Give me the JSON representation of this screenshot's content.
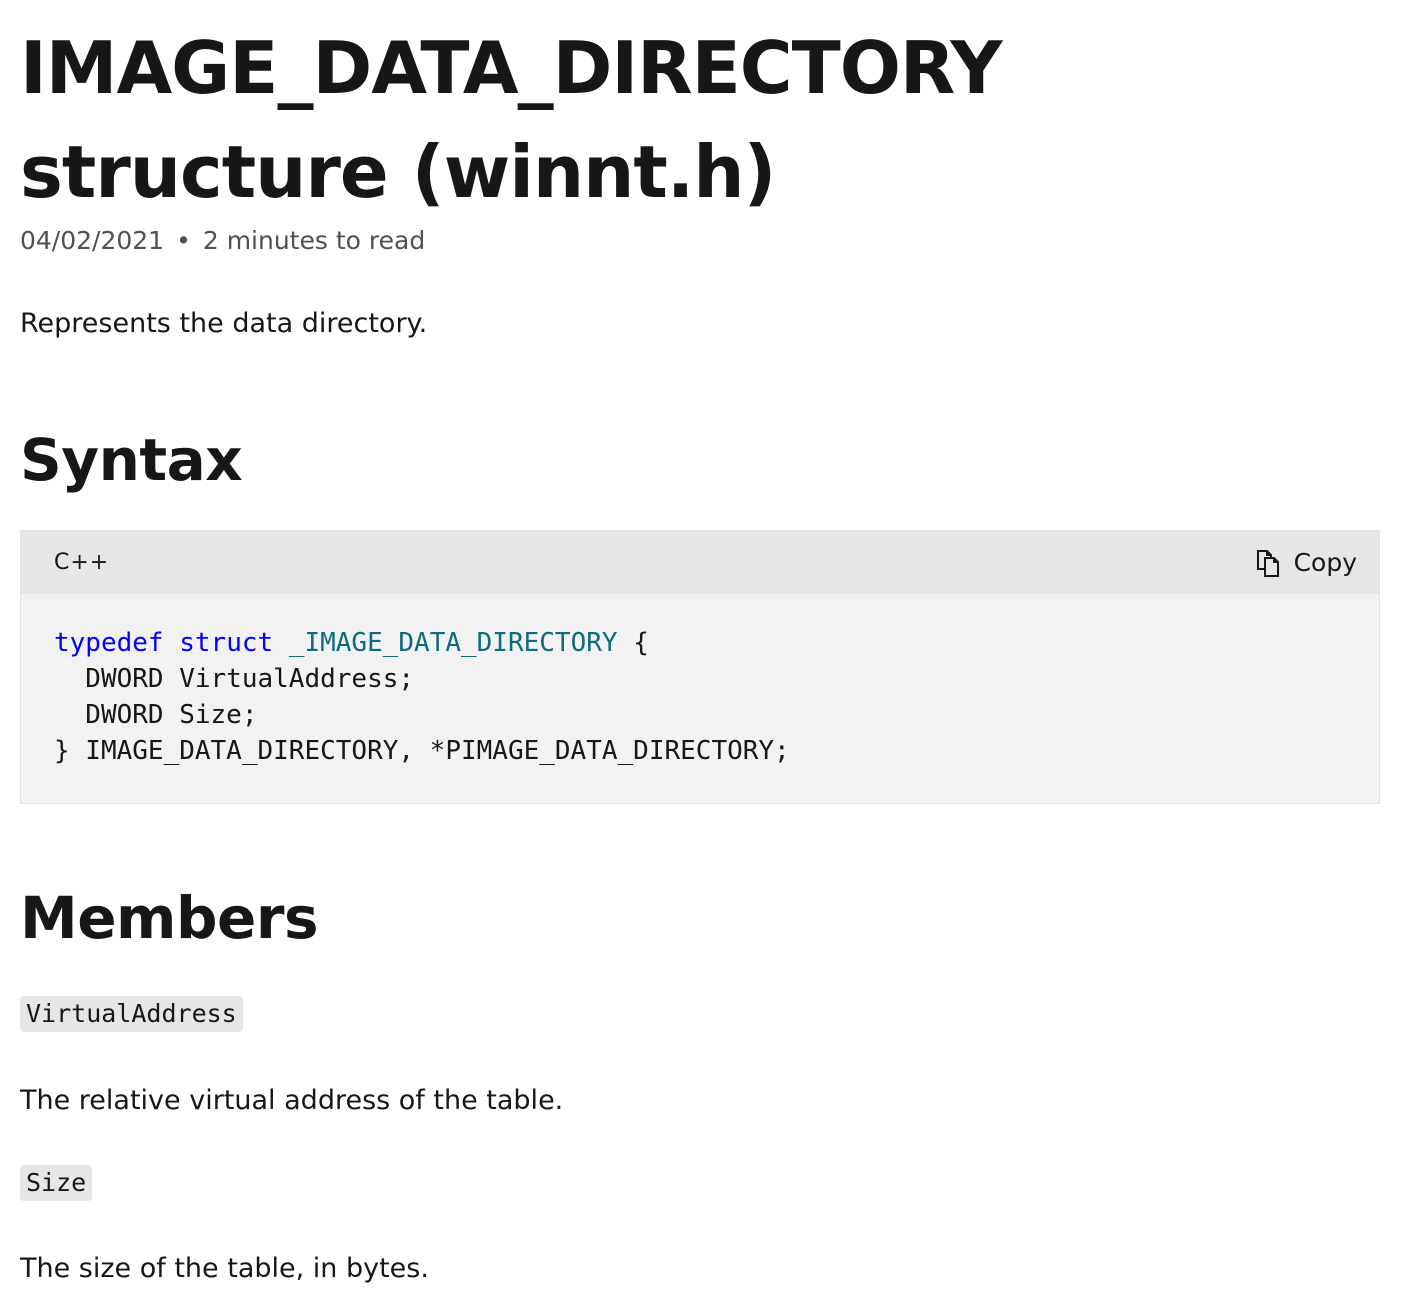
{
  "article": {
    "title": "IMAGE_DATA_DIRECTORY structure (winnt.h)",
    "date": "04/02/2021",
    "separator": "•",
    "read_time": "2 minutes to read",
    "summary": "Represents the data directory."
  },
  "syntax": {
    "heading": "Syntax",
    "language": "C++",
    "copy_label": "Copy",
    "copy_icon": "copy-icon",
    "code": {
      "line1_kw1": "typedef",
      "line1_kw2": "struct",
      "line1_type": "_IMAGE_DATA_DIRECTORY",
      "line1_rest": " {",
      "line2": "  DWORD VirtualAddress;",
      "line3": "  DWORD Size;",
      "line4": "} IMAGE_DATA_DIRECTORY, *PIMAGE_DATA_DIRECTORY;"
    }
  },
  "members": {
    "heading": "Members",
    "items": [
      {
        "name": "VirtualAddress",
        "description": "The relative virtual address of the table."
      },
      {
        "name": "Size",
        "description": "The size of the table, in bytes."
      }
    ]
  },
  "colors": {
    "keyword": "#0101fd",
    "type": "#0b6d7b",
    "code_bg": "#f2f2f2",
    "code_header_bg": "#e6e6e6"
  }
}
